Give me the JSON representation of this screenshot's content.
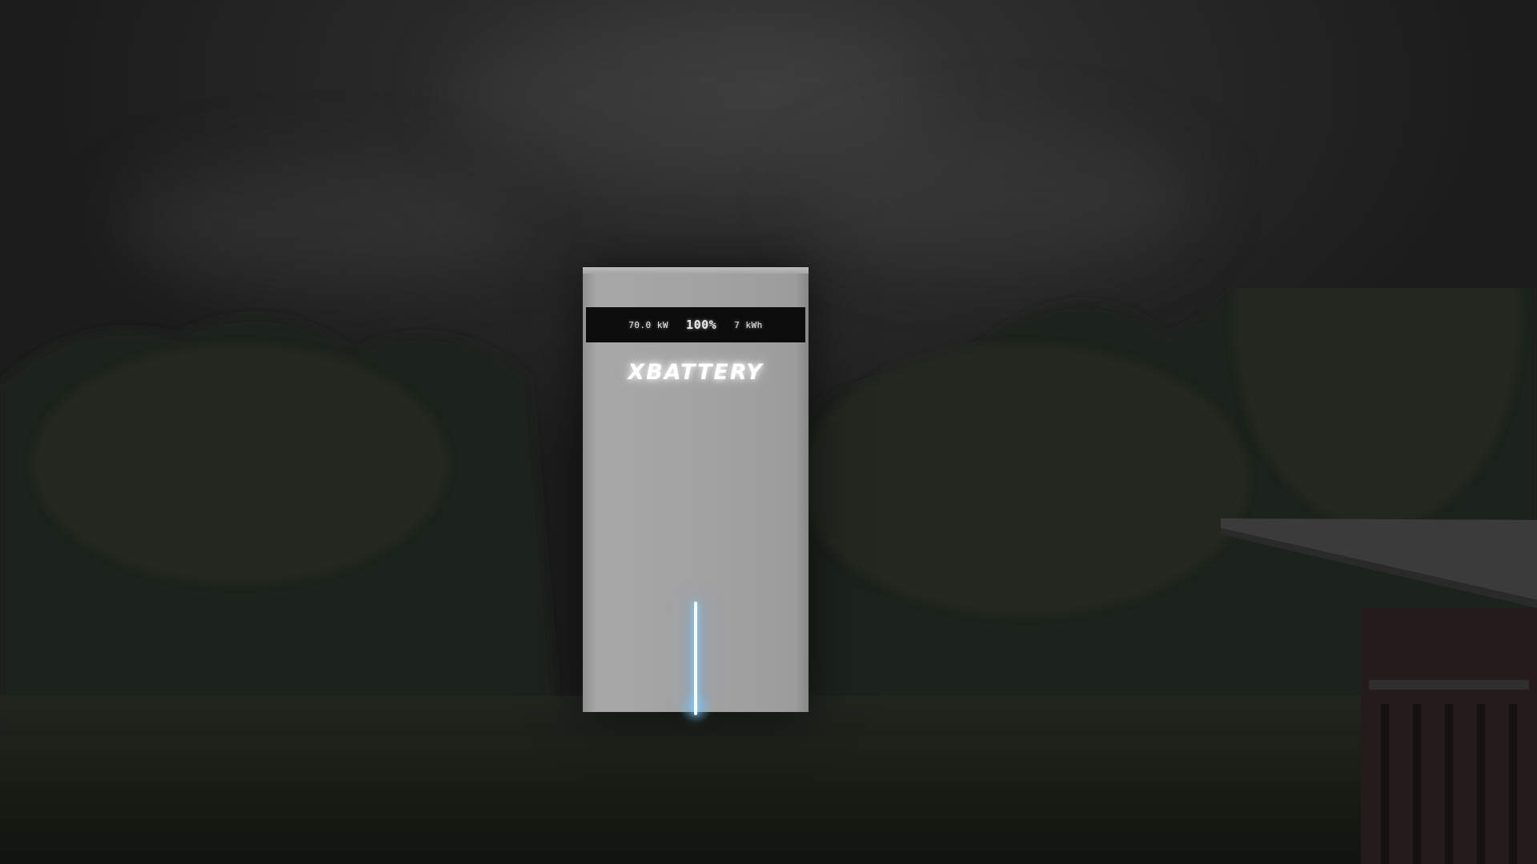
{
  "scene": {
    "device": {
      "brand": "XBATTERY",
      "display": {
        "left_value": "70.0 kW",
        "center_value": "100%",
        "right_value": "7 kWh"
      },
      "light_strip_color": "#8fd0ff",
      "body_color": "#a3a3a3"
    },
    "environment": {
      "sky_color": "#2a2a2a",
      "foliage_color": "#1f241d",
      "ground_color": "#161b14"
    }
  }
}
